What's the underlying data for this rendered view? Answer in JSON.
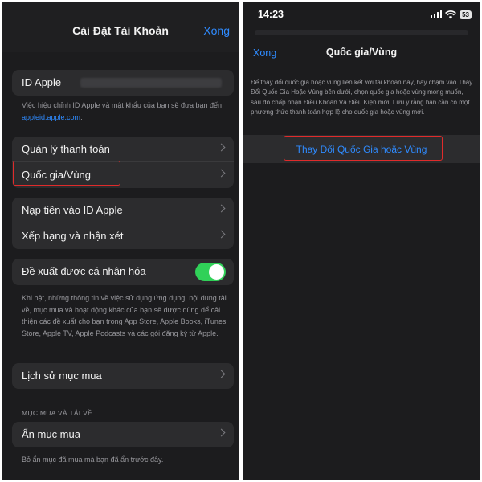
{
  "left": {
    "title": "Cài Đặt Tài Khoản",
    "done": "Xong",
    "apple_id": {
      "label": "ID Apple",
      "note": "Việc hiệu chỉnh ID Apple và mật khẩu của bạn sẽ đưa bạn đến ",
      "note_link": "appleid.apple.com",
      "note_end": "."
    },
    "group_billing": [
      {
        "label": "Quản lý thanh toán"
      },
      {
        "label": "Quốc gia/Vùng"
      }
    ],
    "group_funds": [
      {
        "label": "Nạp tiền vào ID Apple"
      },
      {
        "label": "Xếp hạng và nhận xét"
      }
    ],
    "personalized": {
      "label": "Đề xuất được cá nhân hóa",
      "enabled": true,
      "note": "Khi bật, những thông tin về việc sử dụng ứng dụng, nội dung tải về, mục mua và hoạt động khác của bạn sẽ được dùng để cải thiện các đề xuất cho bạn trong App Store, Apple Books, iTunes Store, Apple TV, Apple Podcasts và các gói đăng ký từ Apple."
    },
    "purchase_history": {
      "label": "Lịch sử mục mua"
    },
    "section_header": "MỤC MUA VÀ TẢI VỀ",
    "hide_purchases": {
      "label": "Ẩn mục mua",
      "note": "Bỏ ẩn mục đã mua mà bạn đã ẩn trước đây."
    }
  },
  "right": {
    "status": {
      "time": "14:23",
      "battery": "53"
    },
    "done": "Xong",
    "title": "Quốc gia/Vùng",
    "description": "Để thay đổi quốc gia hoặc vùng liên kết với tài khoản này, hãy chạm vào Thay Đổi Quốc Gia Hoặc Vùng bên dưới, chọn quốc gia hoặc vùng mong muốn, sau đó chấp nhận Điều Khoản Và Điều Kiện mới. Lưu ý rằng bạn cần có một phương thức thanh toán hợp lệ cho quốc gia hoặc vùng mới.",
    "action": "Thay Đổi Quốc Gia hoặc Vùng"
  },
  "colors": {
    "accent": "#2f8bff",
    "highlight": "#e02b2b",
    "toggle_on": "#30d158",
    "background": "#1c1c1e",
    "cell": "#2c2c2e"
  }
}
